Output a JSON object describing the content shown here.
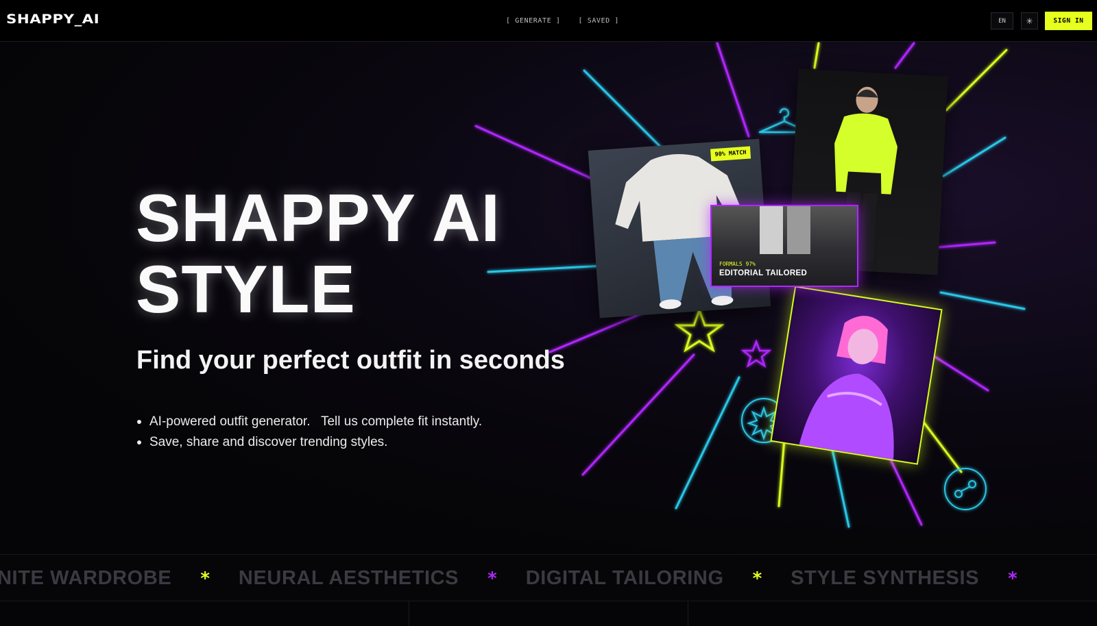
{
  "header": {
    "brand": "SHAPPY_AI",
    "nav": [
      {
        "label": "[ GENERATE ]"
      },
      {
        "label": "[ SAVED ]"
      }
    ],
    "lang": "EN",
    "theme_icon": "sun-icon",
    "signin_label": "SIGN IN"
  },
  "hero": {
    "title_line1": "SHAPPY AI",
    "title_line2": "STYLE",
    "subtitle": "Find your perfect outfit in seconds",
    "bullets": [
      "AI-powered outfit generator.   Tell us complete fit instantly.",
      "Save, share and discover trending styles."
    ],
    "cards": {
      "match_badge": "90% MATCH",
      "editorial_kicker": "FORMALS 97%",
      "editorial_title": "EDITORIAL TAILORED"
    }
  },
  "ticker": {
    "items": [
      "NITE WARDROBE",
      "NEURAL AESTHETICS",
      "DIGITAL TAILORING",
      "STYLE SYNTHESIS"
    ],
    "star": "*",
    "star_colors": [
      "#e6ff1f",
      "#b026ff",
      "#e6ff1f",
      "#b026ff"
    ]
  },
  "colors": {
    "accent_yellow": "#e6ff1f",
    "accent_purple": "#b026ff",
    "accent_cyan": "#29c6e6"
  }
}
